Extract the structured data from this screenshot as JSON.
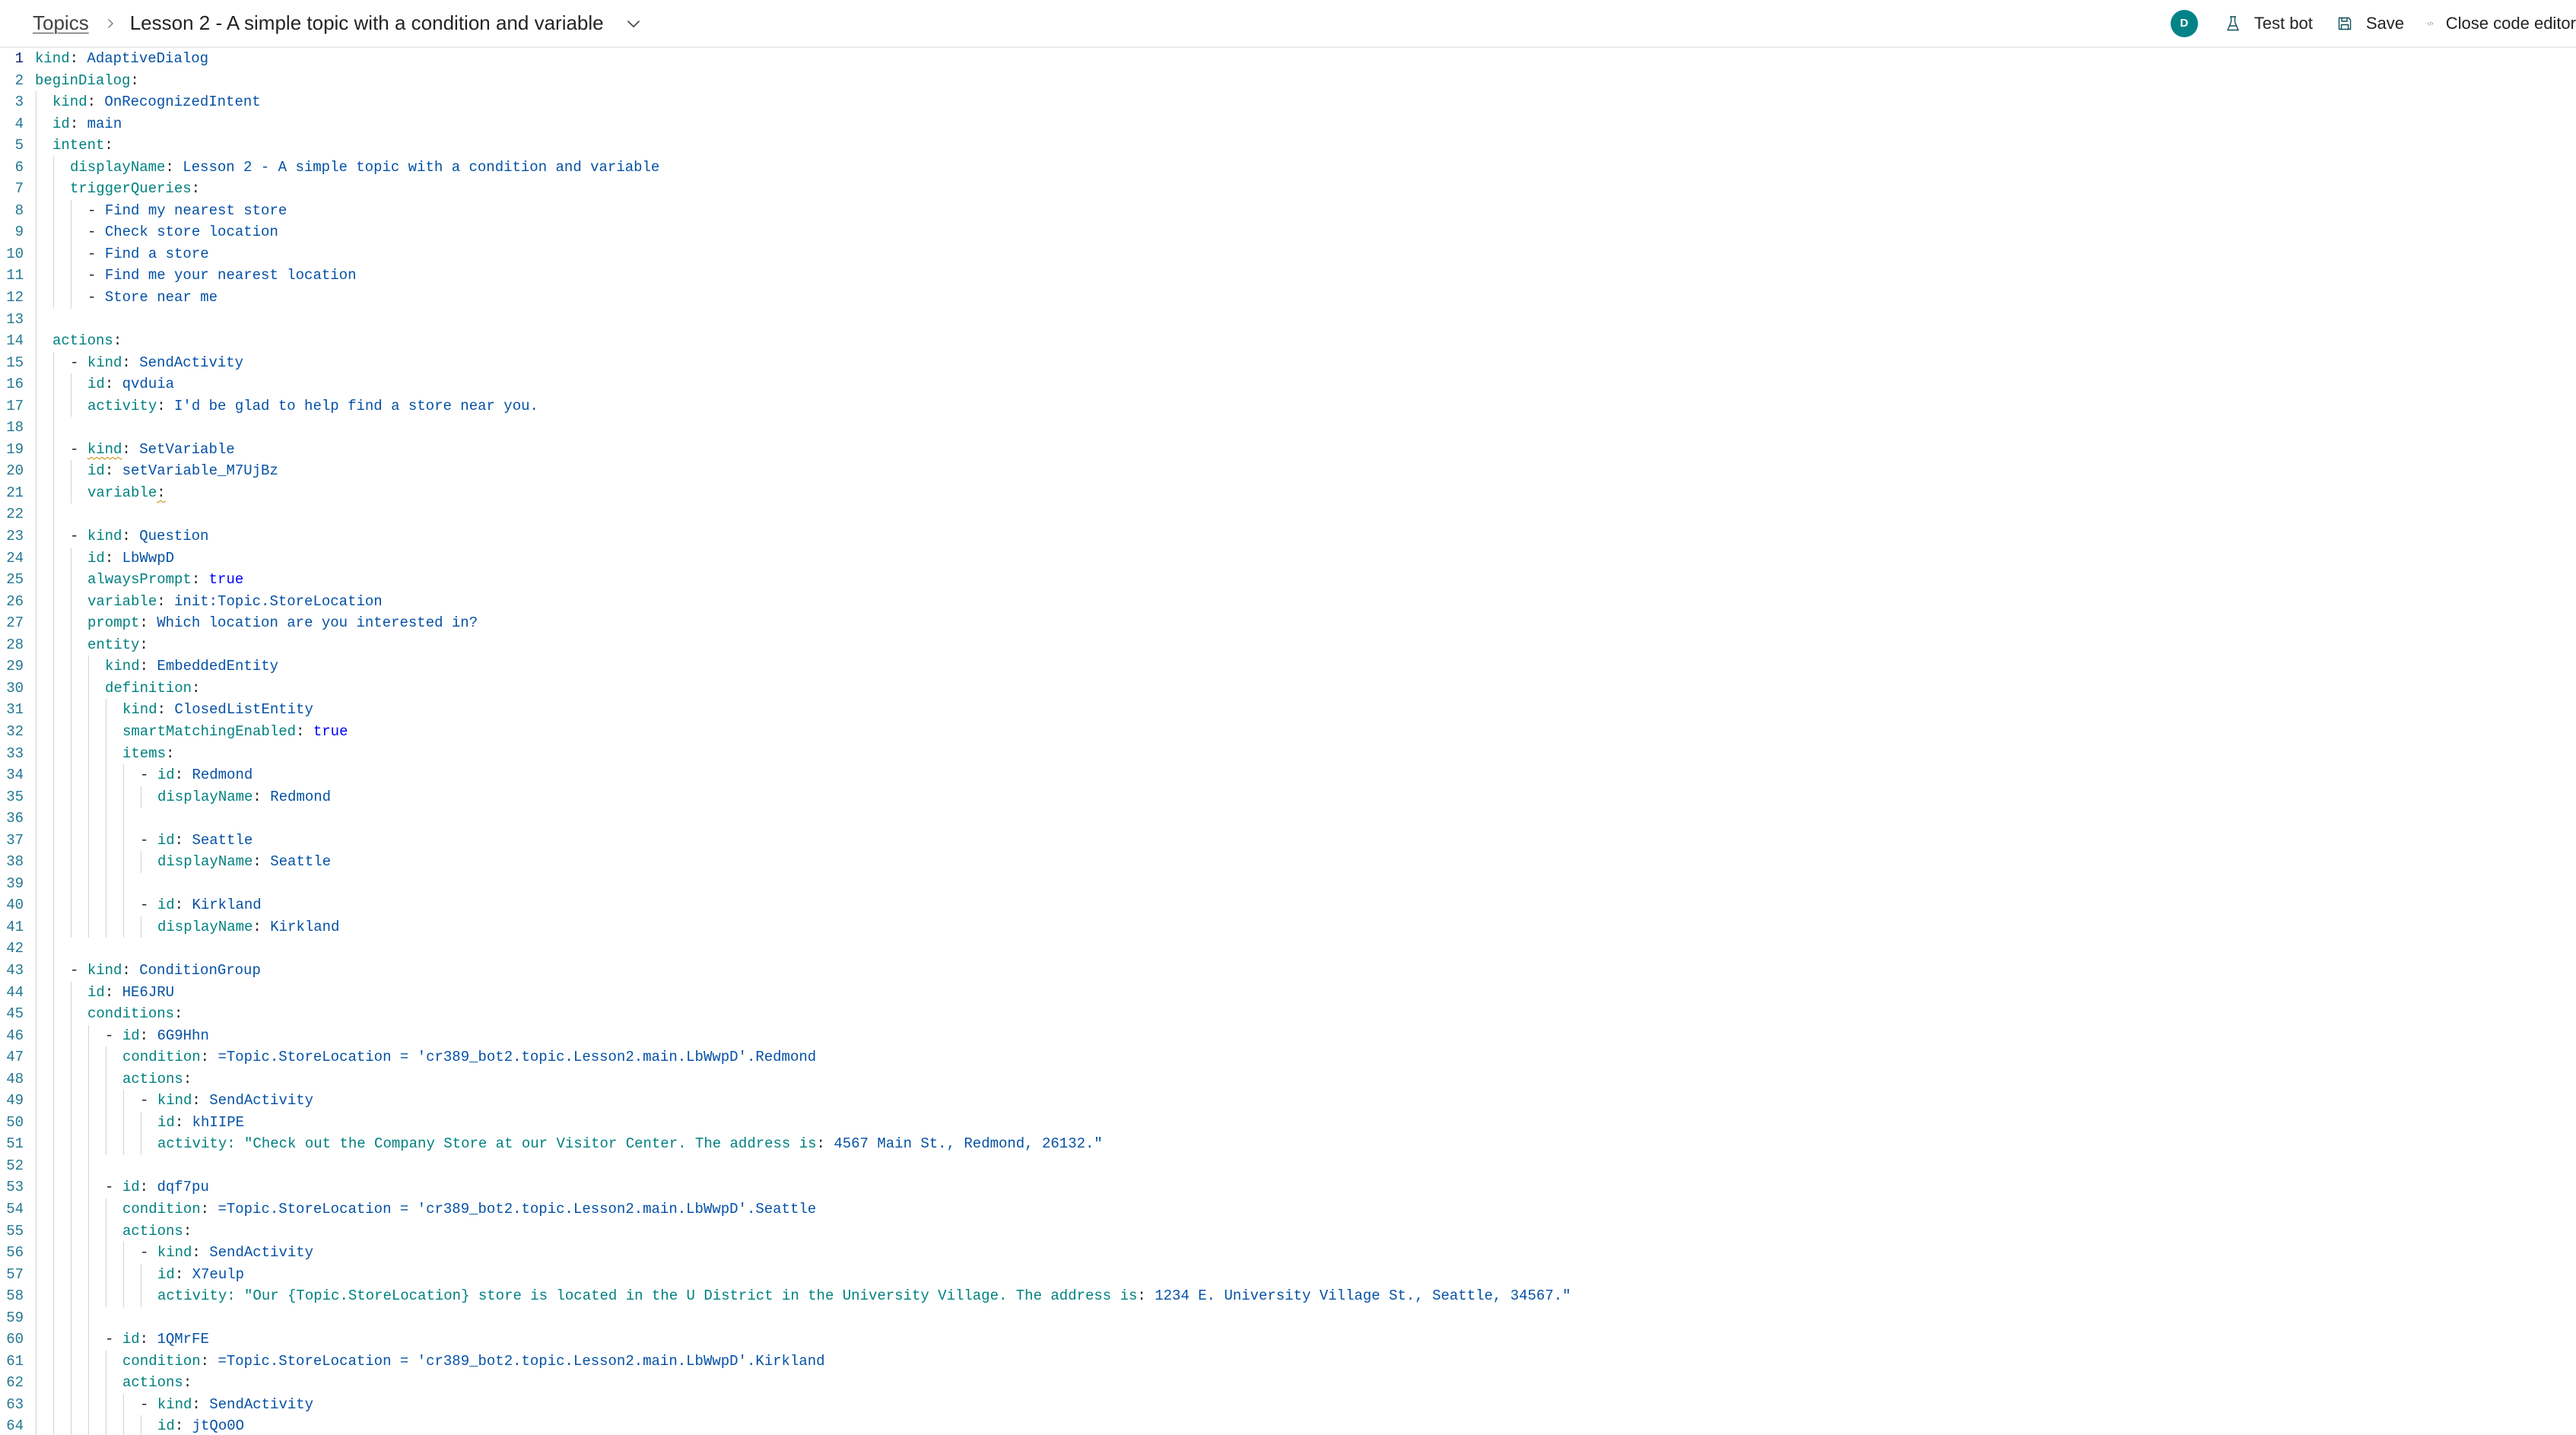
{
  "header": {
    "breadcrumb_root": "Topics",
    "topic_title": "Lesson 2 - A simple topic with a condition and variable",
    "avatar_initial": "D",
    "test_bot_label": "Test bot",
    "save_label": "Save",
    "close_code_editor_label": "Close code editor",
    "icons": {
      "breadcrumb_separator": "chevron-right-icon",
      "title_dropdown": "chevron-down-icon",
      "test_bot": "beaker-icon",
      "save": "save-icon",
      "close_code_editor": "code-icon"
    },
    "colors": {
      "avatar_bg": "#038387",
      "icon_stroke": "#0e4e5a"
    }
  },
  "editor": {
    "language": "yaml",
    "active_line": 1,
    "colors": {
      "key": "#008080",
      "string": "#0451a5",
      "boolean": "#0000ff",
      "line_number": "#237893",
      "warning_squiggle": "#bf8803"
    },
    "lines": [
      {
        "n": 1,
        "i": 0,
        "t": [
          [
            "k",
            "kind"
          ],
          [
            "p",
            ": "
          ],
          [
            "v",
            "AdaptiveDialog"
          ]
        ]
      },
      {
        "n": 2,
        "i": 0,
        "t": [
          [
            "k",
            "beginDialog"
          ],
          [
            "p",
            ":"
          ]
        ]
      },
      {
        "n": 3,
        "i": 1,
        "t": [
          [
            "k",
            "kind"
          ],
          [
            "p",
            ": "
          ],
          [
            "v",
            "OnRecognizedIntent"
          ]
        ]
      },
      {
        "n": 4,
        "i": 1,
        "t": [
          [
            "k",
            "id"
          ],
          [
            "p",
            ": "
          ],
          [
            "v",
            "main"
          ]
        ]
      },
      {
        "n": 5,
        "i": 1,
        "t": [
          [
            "k",
            "intent"
          ],
          [
            "p",
            ":"
          ]
        ]
      },
      {
        "n": 6,
        "i": 2,
        "t": [
          [
            "k",
            "displayName"
          ],
          [
            "p",
            ": "
          ],
          [
            "v",
            "Lesson 2 - A simple topic with a condition and variable"
          ]
        ]
      },
      {
        "n": 7,
        "i": 2,
        "t": [
          [
            "k",
            "triggerQueries"
          ],
          [
            "p",
            ":"
          ]
        ]
      },
      {
        "n": 8,
        "i": 3,
        "t": [
          [
            "d",
            "- "
          ],
          [
            "v",
            "Find my nearest store"
          ]
        ]
      },
      {
        "n": 9,
        "i": 3,
        "t": [
          [
            "d",
            "- "
          ],
          [
            "v",
            "Check store location"
          ]
        ]
      },
      {
        "n": 10,
        "i": 3,
        "t": [
          [
            "d",
            "- "
          ],
          [
            "v",
            "Find a store"
          ]
        ]
      },
      {
        "n": 11,
        "i": 3,
        "t": [
          [
            "d",
            "- "
          ],
          [
            "v",
            "Find me your nearest location"
          ]
        ]
      },
      {
        "n": 12,
        "i": 3,
        "t": [
          [
            "d",
            "- "
          ],
          [
            "v",
            "Store near me"
          ]
        ]
      },
      {
        "n": 13,
        "i": 0,
        "t": []
      },
      {
        "n": 14,
        "i": 1,
        "t": [
          [
            "k",
            "actions"
          ],
          [
            "p",
            ":"
          ]
        ]
      },
      {
        "n": 15,
        "i": 2,
        "t": [
          [
            "d",
            "- "
          ],
          [
            "k",
            "kind"
          ],
          [
            "p",
            ": "
          ],
          [
            "v",
            "SendActivity"
          ]
        ]
      },
      {
        "n": 16,
        "i": 3,
        "t": [
          [
            "k",
            "id"
          ],
          [
            "p",
            ": "
          ],
          [
            "v",
            "qvduia"
          ]
        ]
      },
      {
        "n": 17,
        "i": 3,
        "t": [
          [
            "k",
            "activity"
          ],
          [
            "p",
            ": "
          ],
          [
            "v",
            "I'd be glad to help find a store near you."
          ]
        ]
      },
      {
        "n": 18,
        "i": 0,
        "t": []
      },
      {
        "n": 19,
        "i": 2,
        "t": [
          [
            "d",
            "- "
          ],
          [
            "ks",
            "kind"
          ],
          [
            "p",
            ": "
          ],
          [
            "v",
            "SetVariable"
          ]
        ]
      },
      {
        "n": 20,
        "i": 3,
        "t": [
          [
            "k",
            "id"
          ],
          [
            "p",
            ": "
          ],
          [
            "v",
            "setVariable_M7UjBz"
          ]
        ]
      },
      {
        "n": 21,
        "i": 3,
        "t": [
          [
            "k",
            "variable"
          ],
          [
            "ps",
            ":"
          ]
        ]
      },
      {
        "n": 22,
        "i": 0,
        "t": []
      },
      {
        "n": 23,
        "i": 2,
        "t": [
          [
            "d",
            "- "
          ],
          [
            "k",
            "kind"
          ],
          [
            "p",
            ": "
          ],
          [
            "v",
            "Question"
          ]
        ]
      },
      {
        "n": 24,
        "i": 3,
        "t": [
          [
            "k",
            "id"
          ],
          [
            "p",
            ": "
          ],
          [
            "v",
            "LbWwpD"
          ]
        ]
      },
      {
        "n": 25,
        "i": 3,
        "t": [
          [
            "k",
            "alwaysPrompt"
          ],
          [
            "p",
            ": "
          ],
          [
            "b",
            "true"
          ]
        ]
      },
      {
        "n": 26,
        "i": 3,
        "t": [
          [
            "k",
            "variable"
          ],
          [
            "p",
            ": "
          ],
          [
            "v",
            "init:Topic.StoreLocation"
          ]
        ]
      },
      {
        "n": 27,
        "i": 3,
        "t": [
          [
            "k",
            "prompt"
          ],
          [
            "p",
            ": "
          ],
          [
            "v",
            "Which location are you interested in?"
          ]
        ]
      },
      {
        "n": 28,
        "i": 3,
        "t": [
          [
            "k",
            "entity"
          ],
          [
            "p",
            ":"
          ]
        ]
      },
      {
        "n": 29,
        "i": 4,
        "t": [
          [
            "k",
            "kind"
          ],
          [
            "p",
            ": "
          ],
          [
            "v",
            "EmbeddedEntity"
          ]
        ]
      },
      {
        "n": 30,
        "i": 4,
        "t": [
          [
            "k",
            "definition"
          ],
          [
            "p",
            ":"
          ]
        ]
      },
      {
        "n": 31,
        "i": 5,
        "t": [
          [
            "k",
            "kind"
          ],
          [
            "p",
            ": "
          ],
          [
            "v",
            "ClosedListEntity"
          ]
        ]
      },
      {
        "n": 32,
        "i": 5,
        "t": [
          [
            "k",
            "smartMatchingEnabled"
          ],
          [
            "p",
            ": "
          ],
          [
            "b",
            "true"
          ]
        ]
      },
      {
        "n": 33,
        "i": 5,
        "t": [
          [
            "k",
            "items"
          ],
          [
            "p",
            ":"
          ]
        ]
      },
      {
        "n": 34,
        "i": 6,
        "t": [
          [
            "d",
            "- "
          ],
          [
            "k",
            "id"
          ],
          [
            "p",
            ": "
          ],
          [
            "v",
            "Redmond"
          ]
        ]
      },
      {
        "n": 35,
        "i": 7,
        "t": [
          [
            "k",
            "displayName"
          ],
          [
            "p",
            ": "
          ],
          [
            "v",
            "Redmond"
          ]
        ]
      },
      {
        "n": 36,
        "i": 0,
        "t": []
      },
      {
        "n": 37,
        "i": 6,
        "t": [
          [
            "d",
            "- "
          ],
          [
            "k",
            "id"
          ],
          [
            "p",
            ": "
          ],
          [
            "v",
            "Seattle"
          ]
        ]
      },
      {
        "n": 38,
        "i": 7,
        "t": [
          [
            "k",
            "displayName"
          ],
          [
            "p",
            ": "
          ],
          [
            "v",
            "Seattle"
          ]
        ]
      },
      {
        "n": 39,
        "i": 0,
        "t": []
      },
      {
        "n": 40,
        "i": 6,
        "t": [
          [
            "d",
            "- "
          ],
          [
            "k",
            "id"
          ],
          [
            "p",
            ": "
          ],
          [
            "v",
            "Kirkland"
          ]
        ]
      },
      {
        "n": 41,
        "i": 7,
        "t": [
          [
            "k",
            "displayName"
          ],
          [
            "p",
            ": "
          ],
          [
            "v",
            "Kirkland"
          ]
        ]
      },
      {
        "n": 42,
        "i": 0,
        "t": []
      },
      {
        "n": 43,
        "i": 2,
        "t": [
          [
            "d",
            "- "
          ],
          [
            "k",
            "kind"
          ],
          [
            "p",
            ": "
          ],
          [
            "v",
            "ConditionGroup"
          ]
        ]
      },
      {
        "n": 44,
        "i": 3,
        "t": [
          [
            "k",
            "id"
          ],
          [
            "p",
            ": "
          ],
          [
            "v",
            "HE6JRU"
          ]
        ]
      },
      {
        "n": 45,
        "i": 3,
        "t": [
          [
            "k",
            "conditions"
          ],
          [
            "p",
            ":"
          ]
        ]
      },
      {
        "n": 46,
        "i": 4,
        "t": [
          [
            "d",
            "- "
          ],
          [
            "k",
            "id"
          ],
          [
            "p",
            ": "
          ],
          [
            "v",
            "6G9Hhn"
          ]
        ]
      },
      {
        "n": 47,
        "i": 5,
        "t": [
          [
            "k",
            "condition"
          ],
          [
            "p",
            ": "
          ],
          [
            "v",
            "=Topic.StoreLocation = 'cr389_bot2.topic.Lesson2.main.LbWwpD'.Redmond"
          ]
        ]
      },
      {
        "n": 48,
        "i": 5,
        "t": [
          [
            "k",
            "actions"
          ],
          [
            "p",
            ":"
          ]
        ]
      },
      {
        "n": 49,
        "i": 6,
        "t": [
          [
            "d",
            "- "
          ],
          [
            "k",
            "kind"
          ],
          [
            "p",
            ": "
          ],
          [
            "v",
            "SendActivity"
          ]
        ]
      },
      {
        "n": 50,
        "i": 7,
        "t": [
          [
            "k",
            "id"
          ],
          [
            "p",
            ": "
          ],
          [
            "v",
            "khIIPE"
          ]
        ]
      },
      {
        "n": 51,
        "i": 7,
        "t": [
          [
            "k",
            "activity: \"Check out the Company Store at our Visitor Center. The address is"
          ],
          [
            "p",
            ": "
          ],
          [
            "v",
            "4567 Main St., Redmond, 26132.\""
          ]
        ]
      },
      {
        "n": 52,
        "i": 0,
        "t": []
      },
      {
        "n": 53,
        "i": 4,
        "t": [
          [
            "d",
            "- "
          ],
          [
            "k",
            "id"
          ],
          [
            "p",
            ": "
          ],
          [
            "v",
            "dqf7pu"
          ]
        ]
      },
      {
        "n": 54,
        "i": 5,
        "t": [
          [
            "k",
            "condition"
          ],
          [
            "p",
            ": "
          ],
          [
            "v",
            "=Topic.StoreLocation = 'cr389_bot2.topic.Lesson2.main.LbWwpD'.Seattle"
          ]
        ]
      },
      {
        "n": 55,
        "i": 5,
        "t": [
          [
            "k",
            "actions"
          ],
          [
            "p",
            ":"
          ]
        ]
      },
      {
        "n": 56,
        "i": 6,
        "t": [
          [
            "d",
            "- "
          ],
          [
            "k",
            "kind"
          ],
          [
            "p",
            ": "
          ],
          [
            "v",
            "SendActivity"
          ]
        ]
      },
      {
        "n": 57,
        "i": 7,
        "t": [
          [
            "k",
            "id"
          ],
          [
            "p",
            ": "
          ],
          [
            "v",
            "X7eulp"
          ]
        ]
      },
      {
        "n": 58,
        "i": 7,
        "t": [
          [
            "k",
            "activity: \"Our {Topic.StoreLocation} store is located in the U District in the University Village. The address is"
          ],
          [
            "p",
            ": "
          ],
          [
            "v",
            "1234 E. University Village St., Seattle, 34567.\""
          ]
        ]
      },
      {
        "n": 59,
        "i": 0,
        "t": []
      },
      {
        "n": 60,
        "i": 4,
        "t": [
          [
            "d",
            "- "
          ],
          [
            "k",
            "id"
          ],
          [
            "p",
            ": "
          ],
          [
            "v",
            "1QMrFE"
          ]
        ]
      },
      {
        "n": 61,
        "i": 5,
        "t": [
          [
            "k",
            "condition"
          ],
          [
            "p",
            ": "
          ],
          [
            "v",
            "=Topic.StoreLocation = 'cr389_bot2.topic.Lesson2.main.LbWwpD'.Kirkland"
          ]
        ]
      },
      {
        "n": 62,
        "i": 5,
        "t": [
          [
            "k",
            "actions"
          ],
          [
            "p",
            ":"
          ]
        ]
      },
      {
        "n": 63,
        "i": 6,
        "t": [
          [
            "d",
            "- "
          ],
          [
            "k",
            "kind"
          ],
          [
            "p",
            ": "
          ],
          [
            "v",
            "SendActivity"
          ]
        ]
      },
      {
        "n": 64,
        "i": 7,
        "t": [
          [
            "k",
            "id"
          ],
          [
            "p",
            ": "
          ],
          [
            "v",
            "jtQo0O"
          ]
        ]
      }
    ]
  }
}
